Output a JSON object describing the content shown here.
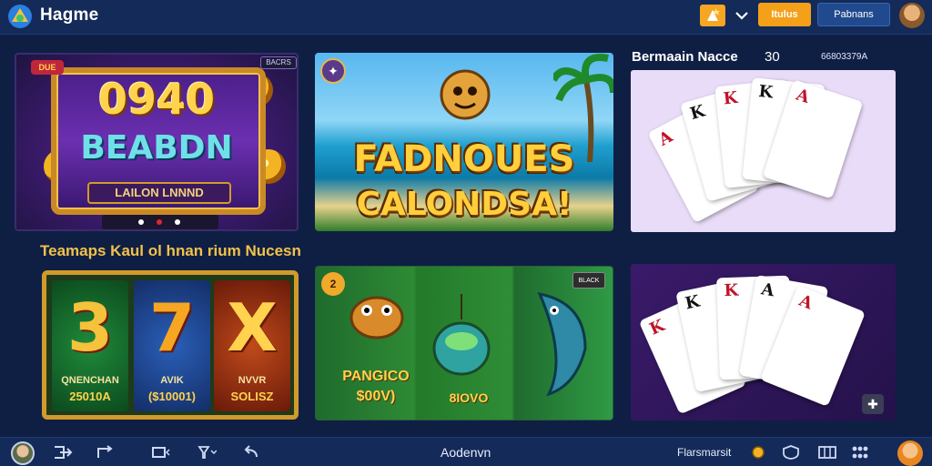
{
  "header": {
    "title": "Hagme",
    "tiny_tag": "",
    "btn_primary": "Itulus",
    "btn_secondary": "Pabnans",
    "icons": [
      "app-logo-icon",
      "star-icon",
      "chevron-down-icon",
      "avatar"
    ]
  },
  "featured": {
    "card1": {
      "title_line1": "0940",
      "title_line2": "BEABDN",
      "banner": "LAILON LNNND",
      "tag_left": "DUE",
      "tag_right": "BACRS"
    },
    "card2": {
      "title_line1": "FADNOUES",
      "title_line2": "CALONDSA!"
    },
    "right_section": {
      "heading": "Bermaain Nacce",
      "count": "30",
      "code": "66803379A"
    }
  },
  "second_row": {
    "heading": "Teamaps Kaul ol hnan rium Nucesn",
    "slots": {
      "reels": [
        {
          "symbol": "3",
          "label1": "QNENCHAN",
          "label2": "25010A"
        },
        {
          "symbol": "7",
          "label1": "AVIK",
          "label2": "($10001)"
        },
        {
          "symbol": "X",
          "label1": "NVVR",
          "label2": "SOLISZ"
        }
      ]
    },
    "fishing": {
      "badge": "2",
      "tag": "BLACK",
      "label1": "PANGICO",
      "label2": "$00V)",
      "label3": "8IOVO"
    }
  },
  "bottom_bar": {
    "center_label": "Aodenvn",
    "right_label": "Flarsmarsit",
    "icons": [
      "profile-avatar",
      "exit-icon",
      "share-icon",
      "window-icon",
      "filter-icon",
      "back-icon",
      "coin-icon",
      "shield-icon",
      "grid-icon",
      "dots-icon",
      "user-avatar"
    ]
  },
  "colors": {
    "background": "#0f1f44",
    "header": "#142a58",
    "accent_orange": "#f4a019",
    "accent_gold": "#f3c24a"
  }
}
